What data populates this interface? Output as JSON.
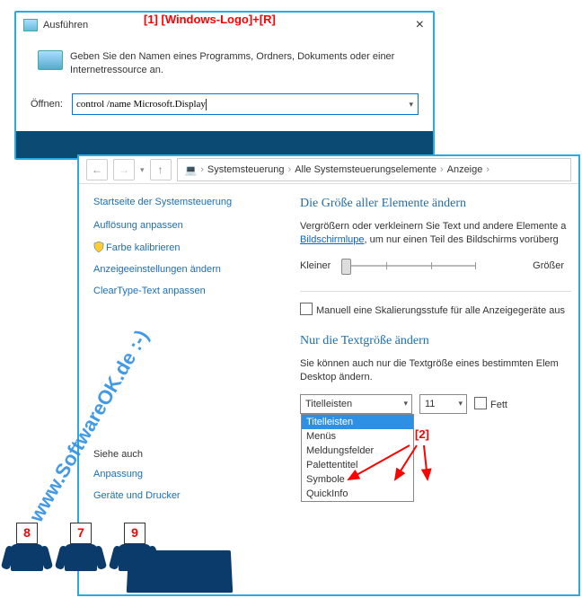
{
  "run": {
    "title": "Ausführen",
    "desc": "Geben Sie den Namen eines Programms, Ordners, Dokuments oder einer Internetressource an.",
    "open_label": "Öffnen:",
    "input_value": "control /name Microsoft.Display",
    "close": "×"
  },
  "annotations": {
    "a1": "[1]  [Windows-Logo]+[R]",
    "a2": "[2]"
  },
  "nav": {
    "pc_icon": "💻",
    "crumbs": [
      "Systemsteuerung",
      "Alle Systemsteuerungselemente",
      "Anzeige"
    ]
  },
  "side": {
    "home": "Startseite der Systemsteuerung",
    "links": [
      "Auflösung anpassen",
      "Farbe kalibrieren",
      "Anzeigeeinstellungen ändern",
      "ClearType-Text anpassen"
    ],
    "see_also": "Siehe auch",
    "see_links": [
      "Anpassung",
      "Geräte und Drucker"
    ]
  },
  "main": {
    "h1": "Die Größe aller Elemente ändern",
    "p1a": "Vergrößern oder verkleinern Sie Text und andere Elemente a",
    "p1link": "Bildschirmlupe",
    "p1b": ", um nur einen Teil des Bildschirms vorüberg",
    "smaller": "Kleiner",
    "larger": "Größer",
    "chk_label": "Manuell eine Skalierungsstufe für alle Anzeigegeräte aus",
    "h2": "Nur die Textgröße ändern",
    "p2": "Sie können auch nur die Textgröße eines bestimmten Elem Desktop ändern.",
    "sel_value": "Titelleisten",
    "size_value": "11",
    "bold_label": "Fett",
    "options": [
      "Titelleisten",
      "Menüs",
      "Meldungsfelder",
      "Palettentitel",
      "Symbole",
      "QuickInfo"
    ]
  },
  "figures": {
    "cards": [
      "8",
      "7",
      "9"
    ]
  },
  "watermark": "www.SoftwareOK.de :-)"
}
